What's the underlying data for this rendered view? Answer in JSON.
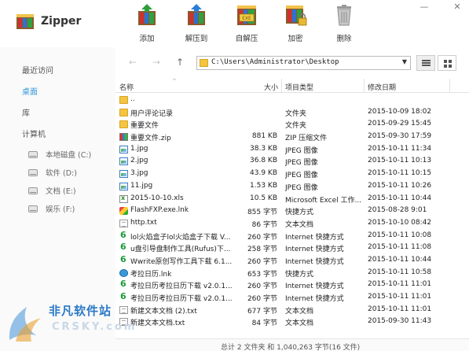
{
  "app": {
    "title": "Zipper"
  },
  "toolbar": [
    {
      "label": "添加",
      "icon": "add-archive-icon"
    },
    {
      "label": "解压到",
      "icon": "extract-to-icon"
    },
    {
      "label": "自解压",
      "icon": "self-extract-icon"
    },
    {
      "label": "加密",
      "icon": "encrypt-icon"
    },
    {
      "label": "删除",
      "icon": "delete-icon"
    }
  ],
  "window_controls": {
    "minimize": "—",
    "close": "✕"
  },
  "sidebar": {
    "recent": "最近访问",
    "desktop": "桌面",
    "library": "库",
    "computer": "计算机",
    "drives": [
      {
        "label": "本地磁盘 (C:)"
      },
      {
        "label": "软件 (D:)"
      },
      {
        "label": "文档 (E:)"
      },
      {
        "label": "娱乐 (F:)"
      }
    ]
  },
  "address": {
    "back": "←",
    "forward": "→",
    "up": "↑",
    "path": "C:\\Users\\Administrator\\Desktop",
    "dropdown": "▼"
  },
  "columns": {
    "name": "名称",
    "size": "大小",
    "type": "项目类型",
    "date": "修改日期"
  },
  "files": [
    {
      "icon": "folder",
      "name": "..",
      "size": "",
      "type": "",
      "date": ""
    },
    {
      "icon": "folder",
      "name": "用户评论记录",
      "size": "",
      "type": "文件夹",
      "date": "2015-10-09 18:02"
    },
    {
      "icon": "folder",
      "name": "重要文件",
      "size": "",
      "type": "文件夹",
      "date": "2015-09-29 15:45"
    },
    {
      "icon": "zip",
      "name": "重要文件.zip",
      "size": "881 KB",
      "type": "ZIP 压缩文件",
      "date": "2015-09-30 17:59"
    },
    {
      "icon": "img",
      "name": "1.jpg",
      "size": "38.3 KB",
      "type": "JPEG 图像",
      "date": "2015-10-11 11:34"
    },
    {
      "icon": "img",
      "name": "2.jpg",
      "size": "36.8 KB",
      "type": "JPEG 图像",
      "date": "2015-10-11 10:13"
    },
    {
      "icon": "img",
      "name": "3.jpg",
      "size": "43.9 KB",
      "type": "JPEG 图像",
      "date": "2015-10-11 10:15"
    },
    {
      "icon": "img",
      "name": "11.jpg",
      "size": "1.53 KB",
      "type": "JPEG 图像",
      "date": "2015-10-11 10:26"
    },
    {
      "icon": "xls",
      "name": "2015-10-10.xls",
      "size": "10.5 KB",
      "type": "Microsoft Excel 工作...",
      "date": "2015-10-11 10:44"
    },
    {
      "icon": "lnk",
      "name": "FlashFXP.exe.lnk",
      "size": "855 字节",
      "type": "快捷方式",
      "date": "2015-08-28 9:01"
    },
    {
      "icon": "txt",
      "name": "http.txt",
      "size": "86 字节",
      "type": "文本文档",
      "date": "2015-10-10 08:42"
    },
    {
      "icon": "url",
      "name": "lol火焰盒子lol火焰盒子下载 V...",
      "size": "260 字节",
      "type": "Internet 快捷方式",
      "date": "2015-10-11 10:08"
    },
    {
      "icon": "url",
      "name": "u盘引导盘制作工具(Rufus)下...",
      "size": "258 字节",
      "type": "Internet 快捷方式",
      "date": "2015-10-11 11:08"
    },
    {
      "icon": "url",
      "name": "Wwrite原创写作工具下载 6.1...",
      "size": "260 字节",
      "type": "Internet 快捷方式",
      "date": "2015-10-11 10:44"
    },
    {
      "icon": "web",
      "name": "考拉日历.lnk",
      "size": "653 字节",
      "type": "快捷方式",
      "date": "2015-10-11 10:58"
    },
    {
      "icon": "url",
      "name": "考拉日历考拉日历下载 v2.0.1...",
      "size": "260 字节",
      "type": "Internet 快捷方式",
      "date": "2015-10-11 11:01"
    },
    {
      "icon": "url",
      "name": "考拉日历考拉日历下载 v2.0.1...",
      "size": "260 字节",
      "type": "Internet 快捷方式",
      "date": "2015-10-11 11:01"
    },
    {
      "icon": "txt",
      "name": "新建文本文档 (2).txt",
      "size": "677 字节",
      "type": "文本文档",
      "date": "2015-10-11 11:01"
    },
    {
      "icon": "txt",
      "name": "新建文本文档.txt",
      "size": "84 字节",
      "type": "文本文档",
      "date": "2015-09-30 11:43"
    }
  ],
  "status": {
    "text": "总计 2 文件夹 和 1,040,263 字节(16 文件)"
  },
  "watermark": {
    "cn": "非凡软件站",
    "en": "CRSKY.com"
  }
}
